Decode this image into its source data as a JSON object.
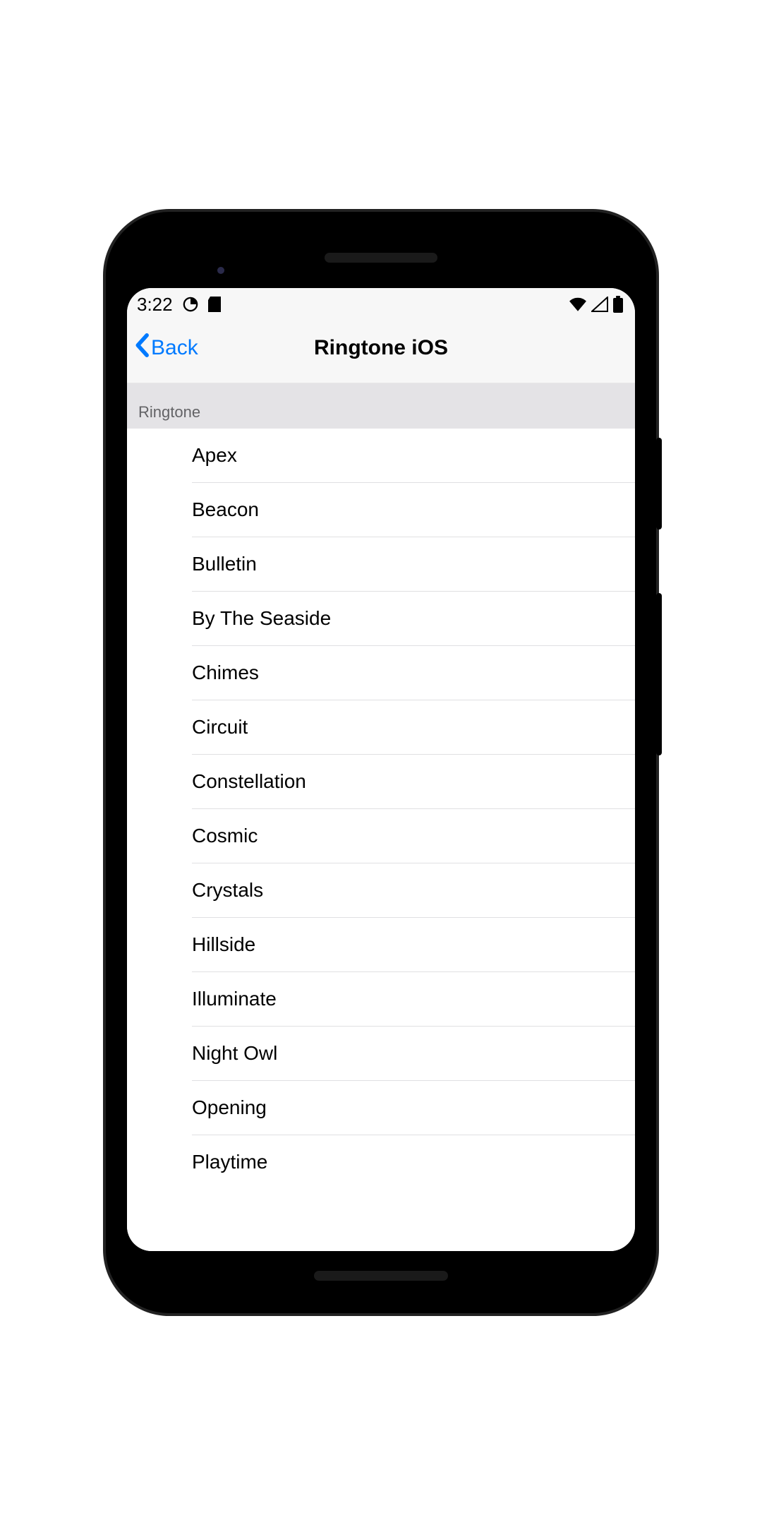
{
  "status": {
    "time": "3:22"
  },
  "nav": {
    "back_label": "Back",
    "title": "Ringtone iOS"
  },
  "section": {
    "header": "Ringtone"
  },
  "ringtones": [
    {
      "label": "Apex"
    },
    {
      "label": "Beacon"
    },
    {
      "label": "Bulletin"
    },
    {
      "label": "By The Seaside"
    },
    {
      "label": "Chimes"
    },
    {
      "label": "Circuit"
    },
    {
      "label": "Constellation"
    },
    {
      "label": "Cosmic"
    },
    {
      "label": "Crystals"
    },
    {
      "label": "Hillside"
    },
    {
      "label": "Illuminate"
    },
    {
      "label": "Night Owl"
    },
    {
      "label": "Opening"
    },
    {
      "label": "Playtime"
    }
  ],
  "colors": {
    "accent": "#007aff",
    "header_bg": "#f7f7f7",
    "section_bg": "#e4e3e6"
  }
}
